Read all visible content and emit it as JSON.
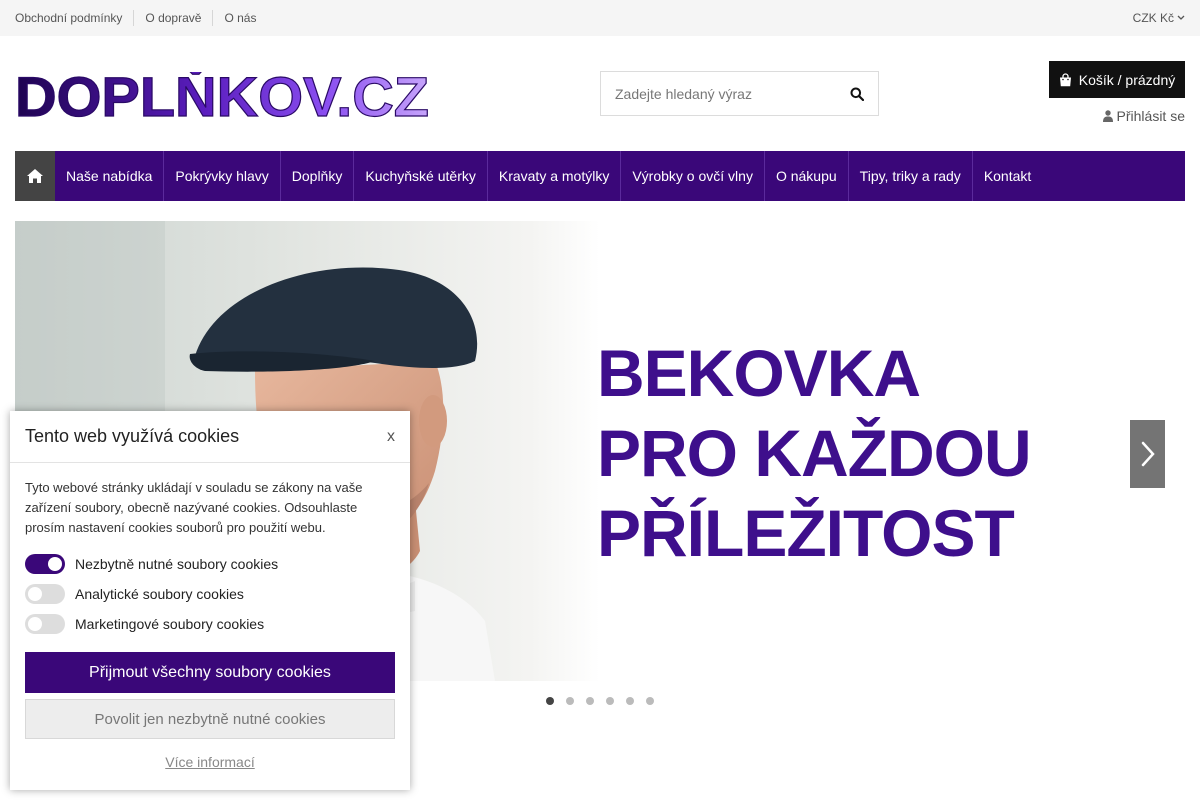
{
  "topbar": {
    "links": [
      "Obchodní podmínky",
      "O dopravě",
      "O nás"
    ],
    "currency": "CZK Kč"
  },
  "header": {
    "logo_text": "DOPLŇKOV.CZ",
    "search_placeholder": "Zadejte hledaný výraz",
    "cart_label": "Košík / prázdný",
    "login_label": "Přihlásit se"
  },
  "nav": {
    "items": [
      "Naše nabídka",
      "Pokrývky hlavy",
      "Doplňky",
      "Kuchyňské utěrky",
      "Kravaty a motýlky",
      "Výrobky o ovčí vlny",
      "O nákupu",
      "Tipy, triky a rady",
      "Kontakt"
    ]
  },
  "hero": {
    "lines": [
      "BEKOVKA",
      "PRO KAŽDOU",
      "PŘÍLEŽITOST"
    ],
    "slide_count": 6,
    "active_slide": 1
  },
  "cookies": {
    "title": "Tento web využívá cookies",
    "close": "x",
    "text": "Tyto webové stránky ukládají v souladu se zákony na vaše zařízení soubory, obecně nazývané cookies. Odsouhlaste prosím nastavení cookies souborů pro použití webu.",
    "options": [
      {
        "label": "Nezbytně nutné soubory cookies",
        "on": true
      },
      {
        "label": "Analytické soubory cookies",
        "on": false
      },
      {
        "label": "Marketingové soubory cookies",
        "on": false
      }
    ],
    "accept_all": "Přijmout všechny soubory cookies",
    "accept_needed": "Povolit jen nezbytně nutné cookies",
    "more": "Více informací"
  },
  "colors": {
    "brand": "#3a0779",
    "headline": "#3e0f8c"
  }
}
